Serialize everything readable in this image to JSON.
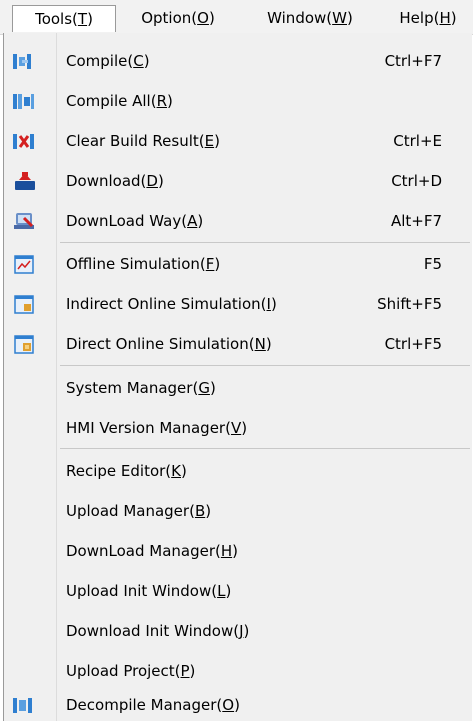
{
  "menubar": [
    {
      "base": "Tools(",
      "key": "T",
      "end": ")",
      "active": true
    },
    {
      "base": "Option(",
      "key": "O",
      "end": ")",
      "active": false
    },
    {
      "base": "Window(",
      "key": "W",
      "end": ")",
      "active": false
    },
    {
      "base": "Help(",
      "key": "H",
      "end": ")",
      "active": false
    }
  ],
  "items": [
    {
      "base": "Compile(",
      "key": "C",
      "end": ")",
      "shortcut": "Ctrl+F7",
      "icon": "compile-icon"
    },
    {
      "base": "Compile All(",
      "key": "R",
      "end": ")",
      "shortcut": "",
      "icon": "compile-all-icon"
    },
    {
      "base": "Clear Build Result(",
      "key": "E",
      "end": ")",
      "shortcut": "Ctrl+E",
      "icon": "clear-build-icon"
    },
    {
      "base": "Download(",
      "key": "D",
      "end": ")",
      "shortcut": "Ctrl+D",
      "icon": "download-icon"
    },
    {
      "base": "DownLoad Way(",
      "key": "A",
      "end": ")",
      "shortcut": "Alt+F7",
      "icon": "download-way-icon"
    },
    {
      "base": "Offline Simulation(",
      "key": "F",
      "end": ")",
      "shortcut": "F5",
      "icon": "offline-simulation-icon"
    },
    {
      "base": "Indirect Online Simulation(",
      "key": "I",
      "end": ")",
      "shortcut": "Shift+F5",
      "icon": "indirect-online-simulation-icon"
    },
    {
      "base": "Direct Online Simulation(",
      "key": "N",
      "end": ")",
      "shortcut": "Ctrl+F5",
      "icon": "direct-online-simulation-icon"
    },
    {
      "base": "System Manager(",
      "key": "G",
      "end": ")",
      "shortcut": "",
      "icon": ""
    },
    {
      "base": "HMI Version Manager(",
      "key": "V",
      "end": ")",
      "shortcut": "",
      "icon": ""
    },
    {
      "base": "Recipe Editor(",
      "key": "K",
      "end": ")",
      "shortcut": "",
      "icon": ""
    },
    {
      "base": "Upload Manager(",
      "key": "B",
      "end": ")",
      "shortcut": "",
      "icon": ""
    },
    {
      "base": "DownLoad Manager(",
      "key": "H",
      "end": ")",
      "shortcut": "",
      "icon": ""
    },
    {
      "base": "Upload Init Window(",
      "key": "L",
      "end": ")",
      "shortcut": "",
      "icon": ""
    },
    {
      "base": "Download Init Window(",
      "key": "J",
      "end": ")",
      "shortcut": "",
      "icon": ""
    },
    {
      "base": "Upload Project(",
      "key": "P",
      "end": ")",
      "shortcut": "",
      "icon": ""
    },
    {
      "base": "Decompile Manager(",
      "key": "O",
      "end": ")",
      "shortcut": "",
      "icon": "decompile-manager-icon"
    }
  ],
  "colors": {
    "accent_blue": "#2f7fd0",
    "accent_red": "#d42020",
    "menu_bg": "#f0f0f0"
  }
}
